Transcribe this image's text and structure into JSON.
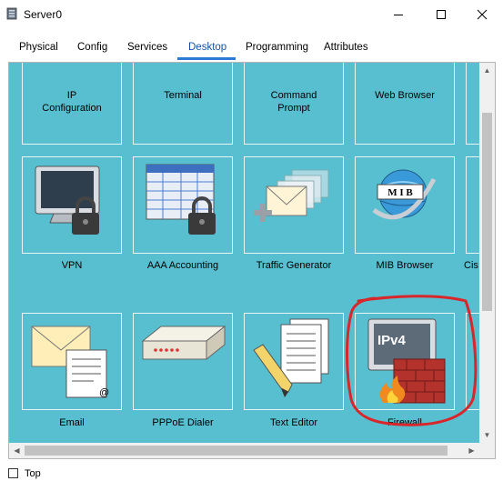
{
  "window": {
    "title": "Server0",
    "app_icon": "server-icon",
    "controls": [
      "minimize-icon",
      "maximize-icon",
      "close-icon"
    ]
  },
  "tabs": [
    "Physical",
    "Config",
    "Services",
    "Desktop",
    "Programming",
    "Attributes"
  ],
  "active_tab": "Desktop",
  "apps": {
    "row1": [
      "IP\nConfiguration",
      "Terminal",
      "Command\nPrompt",
      "Web Browser"
    ],
    "row2": [
      "VPN",
      "AAA Accounting",
      "Traffic Generator",
      "MIB Browser",
      "Cis"
    ],
    "row3": [
      "Email",
      "PPPoE Dialer",
      "Text Editor",
      "Firewall"
    ]
  },
  "firewall_badge": "IPv4",
  "mib_badge": "M I B",
  "annotation": {
    "shape": "hand-drawn circle around Firewall",
    "color": "#d9262b"
  },
  "colors": {
    "desktop_bg": "#57bfcf",
    "active_tab": "#2b7bd6"
  },
  "footer": {
    "checkbox_label": "Top",
    "checked": false
  }
}
